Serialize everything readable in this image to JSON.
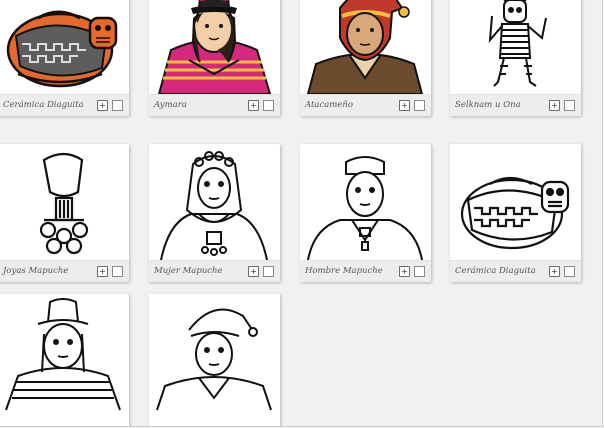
{
  "cards": [
    {
      "label": "Cerámica Diaguita",
      "image": "ceramica-diaguita-color"
    },
    {
      "label": "Aymara",
      "image": "aymara-color"
    },
    {
      "label": "Atacameño",
      "image": "atacameno-color"
    },
    {
      "label": "Selknam u Ona",
      "image": "selknam-color"
    },
    {
      "label": "Joyas Mapuche",
      "image": "joyas-mapuche-lineart"
    },
    {
      "label": "Mujer Mapuche",
      "image": "mujer-mapuche-lineart"
    },
    {
      "label": "Hombre Mapuche",
      "image": "hombre-mapuche-lineart"
    },
    {
      "label": "Cerámica Diaguita",
      "image": "ceramica-diaguita-lineart"
    },
    {
      "label": "",
      "image": "aymara-lineart"
    },
    {
      "label": "",
      "image": "atacameno-lineart"
    }
  ],
  "icons": {
    "add": "add-icon",
    "select": "checkbox-icon"
  },
  "colors": {
    "card_bar": "#ededed",
    "background": "#f1f1f1"
  }
}
